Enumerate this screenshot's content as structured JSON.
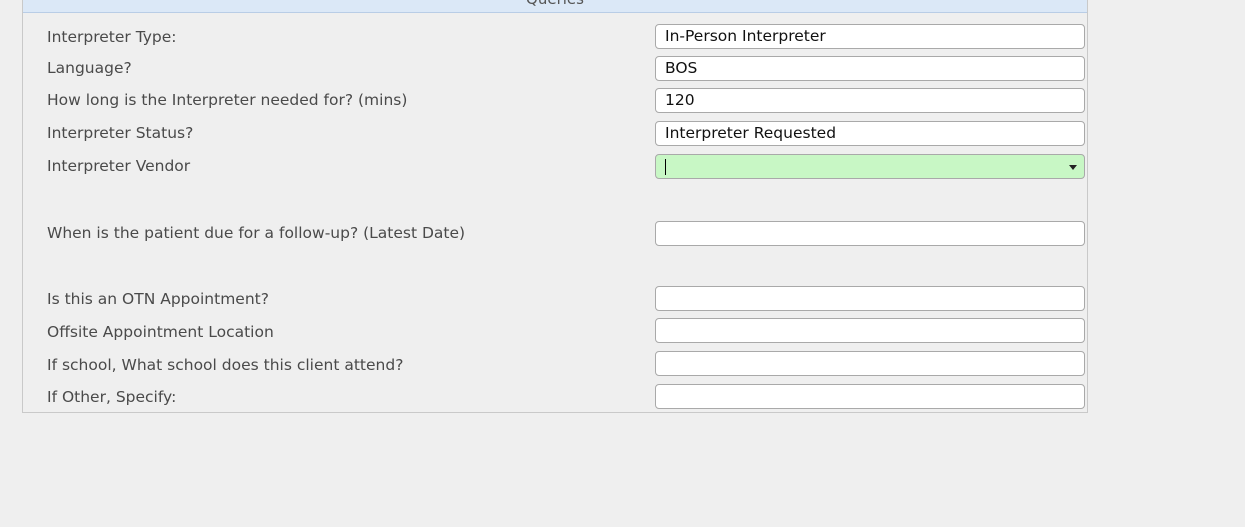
{
  "panel": {
    "header_title": "Queries"
  },
  "form": {
    "interpreter_type": {
      "label": "Interpreter Type:",
      "value": "In-Person Interpreter"
    },
    "language": {
      "label": "Language?",
      "value": "BOS"
    },
    "duration": {
      "label": "How long is the Interpreter needed for? (mins)",
      "value": "120"
    },
    "interpreter_status": {
      "label": "Interpreter Status?",
      "value": "Interpreter Requested"
    },
    "interpreter_vendor": {
      "label": "Interpreter Vendor",
      "value": ""
    },
    "follow_up": {
      "label": "When is the patient due for a follow-up? (Latest Date)",
      "value": ""
    },
    "otn": {
      "label": "Is this an OTN Appointment?",
      "value": ""
    },
    "offsite": {
      "label": "Offsite Appointment Location",
      "value": ""
    },
    "school": {
      "label": "If school, What school does this client attend?",
      "value": ""
    },
    "other": {
      "label": "If Other, Specify:",
      "value": ""
    }
  },
  "colors": {
    "active_select_bg": "#c8f7c5",
    "header_bg": "#dbe8f7"
  },
  "icons": {
    "vendor_dropdown": "chevron-down-icon"
  }
}
